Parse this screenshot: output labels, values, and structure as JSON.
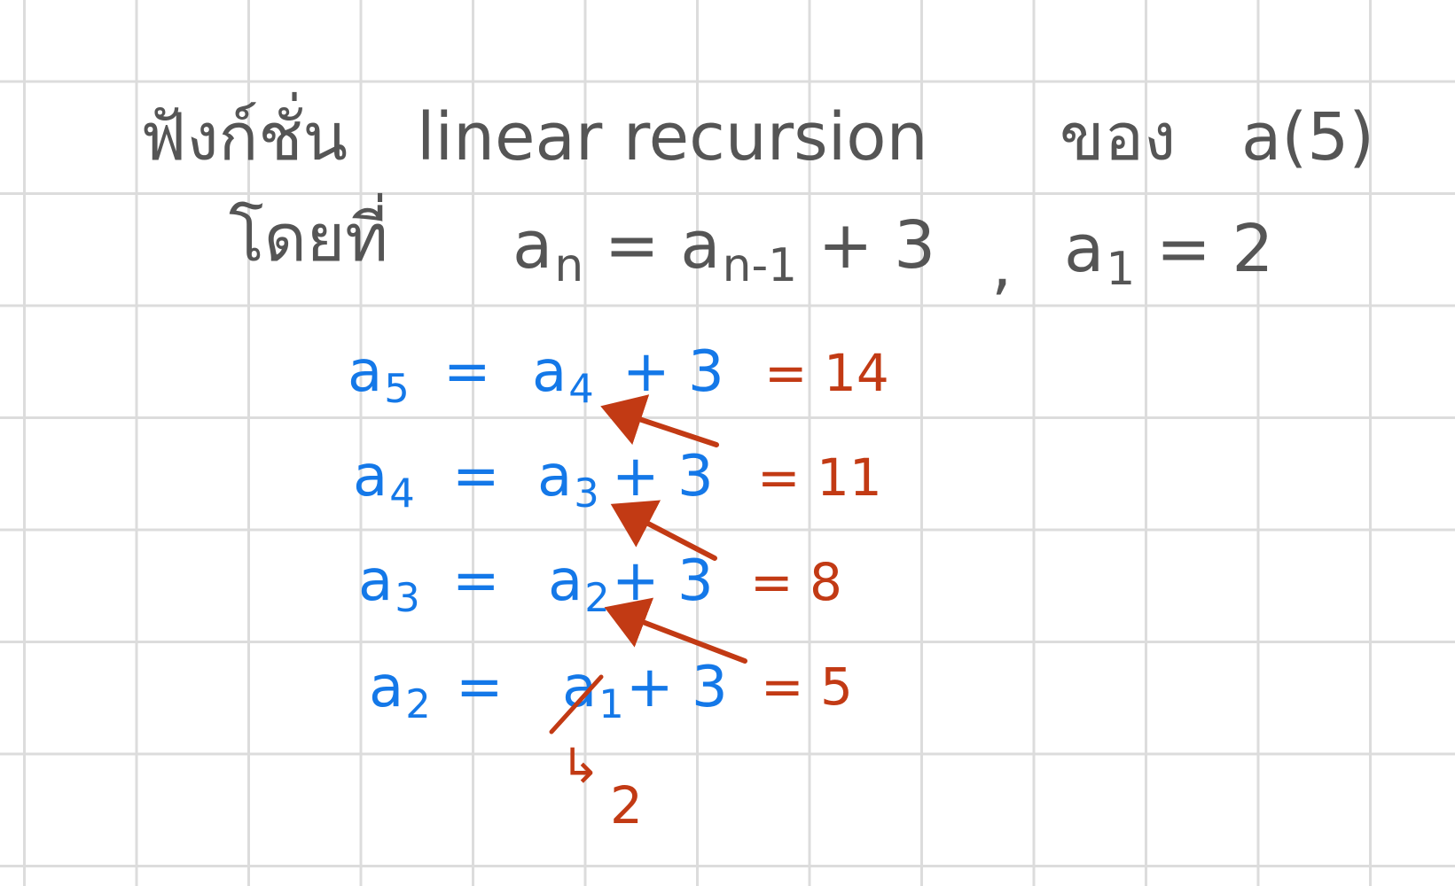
{
  "header": {
    "line1": {
      "thai_function": "ฟังก์ชั่น",
      "term": "linear recursion",
      "thai_of": "ของ",
      "target": "a(5)"
    },
    "line2": {
      "thai_given": "โดยที่",
      "a_letter": "a",
      "n_sub": "n",
      "equals_rhs": "= a",
      "rhs_sub": "n-1",
      "plus_three": "+ 3",
      "comma": ",",
      "initial_letter": "a",
      "initial_sub": "1",
      "initial_value": "= 2"
    }
  },
  "steps": [
    {
      "letter": "a",
      "sub": "5",
      "eq": "=",
      "rhs_letter": "a",
      "rhs_sub": "4",
      "plus": "+ 3",
      "result": "= 14"
    },
    {
      "letter": "a",
      "sub": "4",
      "eq": "=",
      "rhs_letter": "a",
      "rhs_sub": "3",
      "plus": "+ 3",
      "result": "= 11"
    },
    {
      "letter": "a",
      "sub": "3",
      "eq": "=",
      "rhs_letter": "a",
      "rhs_sub": "2",
      "plus": "+ 3",
      "result": "= 8"
    },
    {
      "letter": "a",
      "sub": "2",
      "eq": "=",
      "rhs_letter": "a",
      "rhs_sub": "1",
      "plus": "+ 3",
      "result": "= 5"
    }
  ],
  "substitution": {
    "arrow": "↳",
    "value": "2"
  },
  "colors": {
    "header_ink": "#555555",
    "blue_ink": "#1478e8",
    "red_ink": "#c23a14",
    "grid": "#dcdcdc"
  }
}
